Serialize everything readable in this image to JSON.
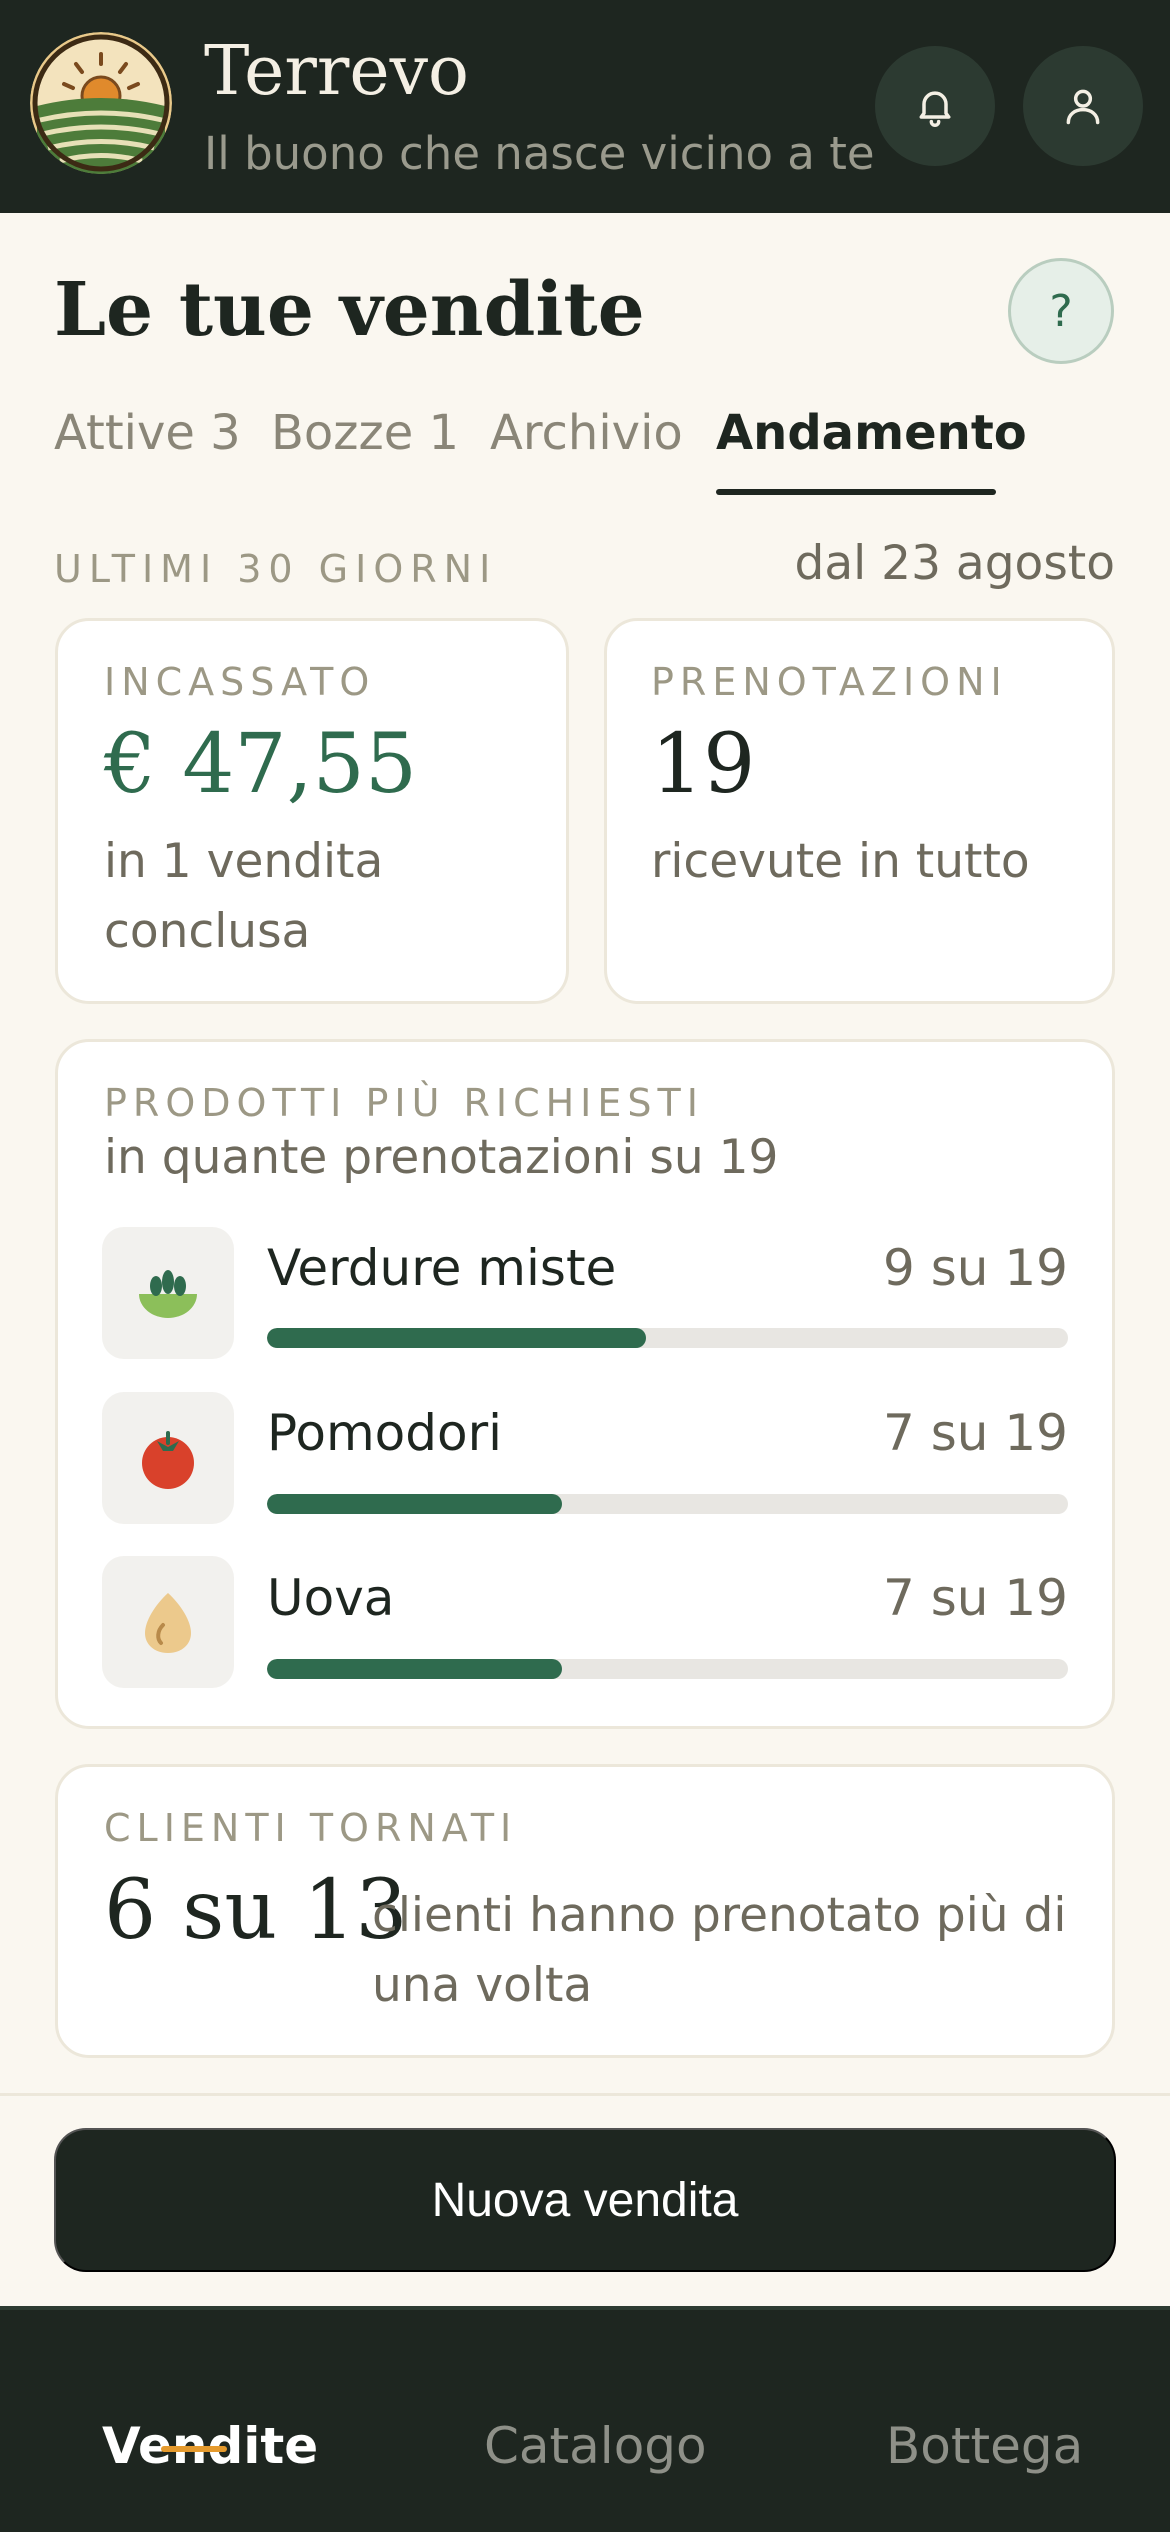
{
  "header": {
    "app_title": "Terrevo",
    "tagline": "Il buono che nasce vicino a te",
    "icons": [
      "bell-icon",
      "user-icon"
    ]
  },
  "page": {
    "title": "Le tue vendite",
    "help_label": "?"
  },
  "tabs": [
    {
      "label": "Attive 3",
      "active": false
    },
    {
      "label": "Bozze 1",
      "active": false
    },
    {
      "label": "Archivio",
      "active": false
    },
    {
      "label": "Andamento",
      "active": true
    }
  ],
  "period": {
    "label": "ULTIMI 30 GIORNI",
    "since": "dal 23 agosto"
  },
  "stats": {
    "revenue": {
      "label": "INCASSATO",
      "value": "€ 47,55",
      "note": "in 1 vendita conclusa"
    },
    "bookings": {
      "label": "PRENOTAZIONI",
      "value": "19",
      "note": "ricevute in tutto"
    }
  },
  "top_products": {
    "label": "PRODOTTI PIÙ RICHIESTI",
    "subtitle": "in quante prenotazioni su 19",
    "total": 19,
    "items": [
      {
        "name": "Verdure miste",
        "count_label": "9 su 19",
        "count": 9,
        "icon": "vegetables-icon"
      },
      {
        "name": "Pomodori",
        "count_label": "7 su 19",
        "count": 7,
        "icon": "tomato-icon"
      },
      {
        "name": "Uova",
        "count_label": "7 su 19",
        "count": 7,
        "icon": "egg-icon"
      }
    ]
  },
  "returning": {
    "label": "CLIENTI TORNATI",
    "value": "6 su 13",
    "note": "clienti hanno prenotato più di una volta"
  },
  "actions": {
    "new_sale": "Nuova vendita"
  },
  "bottom_nav": [
    {
      "label": "Vendite",
      "active": true
    },
    {
      "label": "Catalogo",
      "active": false
    },
    {
      "label": "Bottega",
      "active": false
    }
  ],
  "colors": {
    "dark": "#1e2620",
    "accent_green": "#2f6b4e",
    "highlight": "#e59a2d",
    "background": "#faf7f0"
  }
}
